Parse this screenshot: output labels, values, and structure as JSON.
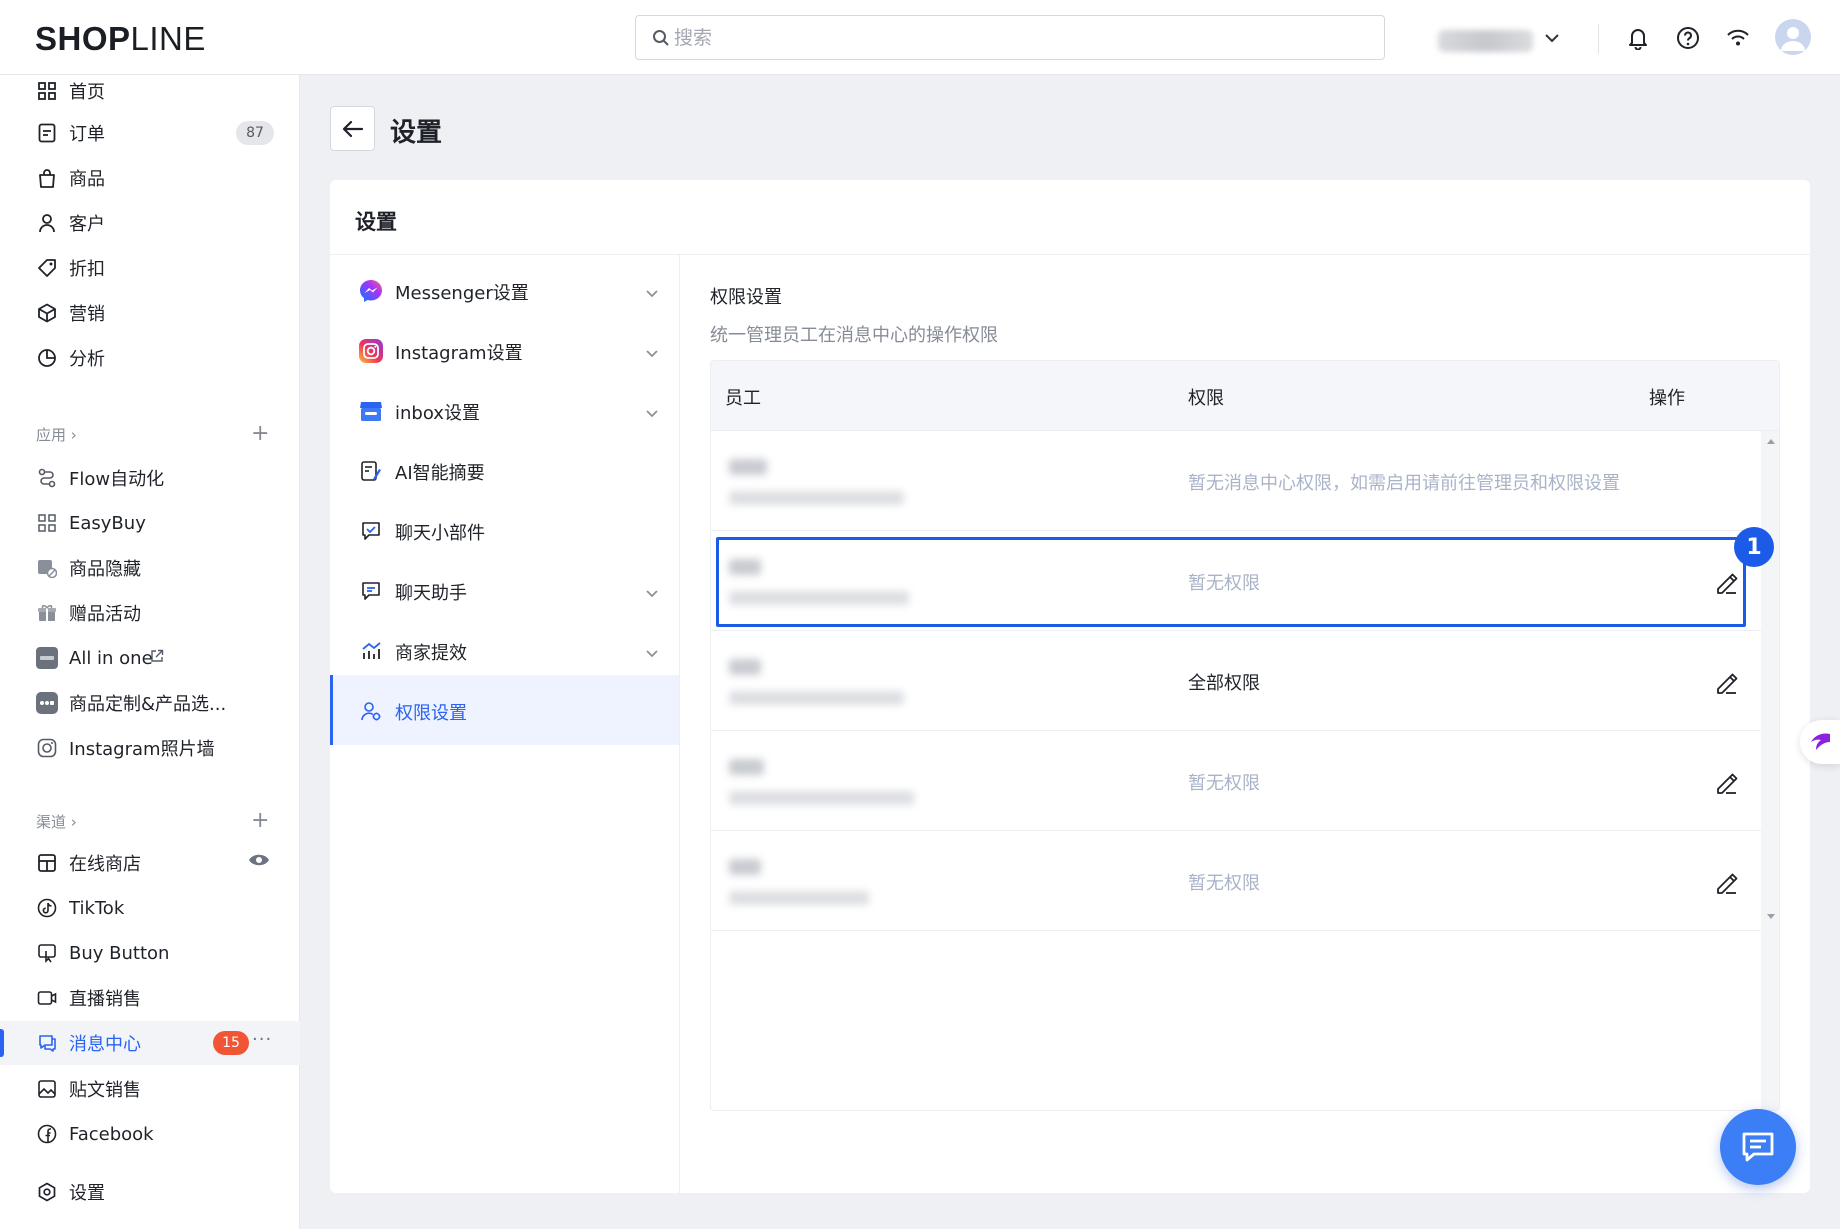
{
  "brand": {
    "logo_bold": "SHOP",
    "logo_light": "LINE"
  },
  "search": {
    "placeholder": "搜索"
  },
  "sidebar": {
    "items": [
      {
        "label": "首页",
        "icon": "grid-icon"
      },
      {
        "label": "订单",
        "icon": "order-icon",
        "badge": "87"
      },
      {
        "label": "商品",
        "icon": "bag-icon"
      },
      {
        "label": "客户",
        "icon": "user-icon"
      },
      {
        "label": "折扣",
        "icon": "tag-icon"
      },
      {
        "label": "营销",
        "icon": "box-icon"
      },
      {
        "label": "分析",
        "icon": "pie-chart-icon"
      }
    ],
    "apps_header": "应用 ›",
    "apps": [
      {
        "label": "Flow自动化",
        "icon": "flow-icon"
      },
      {
        "label": "EasyBuy",
        "icon": "easybuy-icon"
      },
      {
        "label": "商品隐藏",
        "icon": "hide-product-icon"
      },
      {
        "label": "赠品活动",
        "icon": "gift-icon"
      },
      {
        "label": "All in one",
        "icon": "allinone-icon"
      },
      {
        "label": "商品定制&产品选...",
        "icon": "customize-icon"
      },
      {
        "label": "Instagram照片墙",
        "icon": "instagram-icon"
      }
    ],
    "channels_header": "渠道 ›",
    "channels": [
      {
        "label": "在线商店",
        "icon": "store-icon"
      },
      {
        "label": "TikTok",
        "icon": "tiktok-icon"
      },
      {
        "label": "Buy Button",
        "icon": "buy-button-icon"
      },
      {
        "label": "直播销售",
        "icon": "live-icon"
      },
      {
        "label": "消息中心",
        "icon": "message-icon",
        "badge": "15"
      },
      {
        "label": "贴文销售",
        "icon": "post-icon"
      },
      {
        "label": "Facebook",
        "icon": "facebook-icon"
      }
    ],
    "settings_label": "设置",
    "more": "···"
  },
  "page": {
    "title": "设置"
  },
  "card": {
    "title": "设置",
    "menu": [
      {
        "label": "Messenger设置",
        "icon": "messenger-icon",
        "expandable": true
      },
      {
        "label": "Instagram设置",
        "icon": "instagram-icon",
        "expandable": true
      },
      {
        "label": "inbox设置",
        "icon": "inbox-icon",
        "expandable": true
      },
      {
        "label": "AI智能摘要",
        "icon": "ai-summary-icon",
        "expandable": false
      },
      {
        "label": "聊天小部件",
        "icon": "chat-widget-icon",
        "expandable": false
      },
      {
        "label": "聊天助手",
        "icon": "chat-assistant-icon",
        "expandable": true
      },
      {
        "label": "商家提效",
        "icon": "efficiency-icon",
        "expandable": true
      },
      {
        "label": "权限设置",
        "icon": "permission-icon",
        "expandable": false,
        "active": true
      }
    ]
  },
  "permissions": {
    "title": "权限设置",
    "description": "统一管理员工在消息中心的操作权限",
    "columns": [
      "员工",
      "权限",
      "操作"
    ],
    "rows": [
      {
        "permission": "暂无消息中心权限，如需启用请前往管理员和权限设置",
        "style": "muted",
        "editable": false
      },
      {
        "permission": "暂无权限",
        "style": "muted",
        "editable": true
      },
      {
        "permission": "全部权限",
        "style": "strong",
        "editable": true
      },
      {
        "permission": "暂无权限",
        "style": "muted",
        "editable": true
      },
      {
        "permission": "暂无权限",
        "style": "muted",
        "editable": true
      }
    ],
    "marker": "1"
  },
  "colors": {
    "accent": "#2a63f2",
    "badge_red": "#f25535",
    "highlight": "#1c5be8",
    "muted": "#a9b3c8"
  }
}
